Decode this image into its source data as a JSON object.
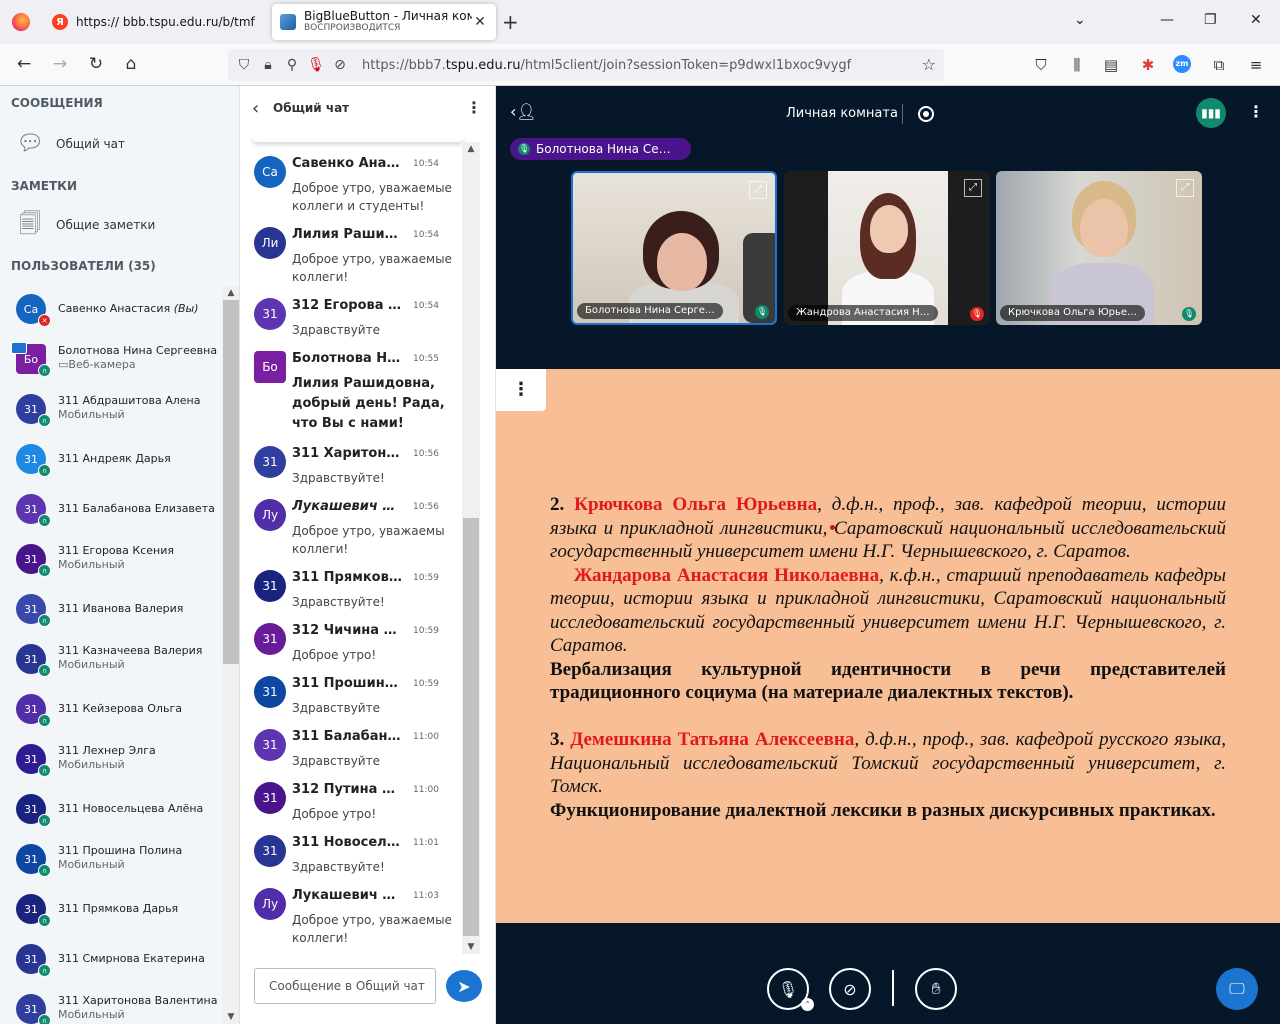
{
  "browser": {
    "tabs": [
      {
        "title": "https:// bbb.tspu.edu.ru/b/tmf",
        "favicon": "yandex-icon"
      },
      {
        "title": "BigBlueButton - Личная комна",
        "subtitle": "ВОСПРОИЗВОДИТСЯ",
        "favicon": "bbb-icon",
        "active": true
      }
    ],
    "url_prefix": "https://bbb7.",
    "url_domain": "tspu.edu.ru",
    "url_path": "/html5client/join?sessionToken=p9dwxl1bxoc9vygf",
    "yandex_letter": "Я",
    "zoom_label": "zm"
  },
  "left_panel": {
    "messages_title": "СООБЩЕНИЯ",
    "public_chat": "Общий чат",
    "notes_title": "ЗАМЕТКИ",
    "shared_notes": "Общие заметки",
    "users_title": "ПОЛЬЗОВАТЕЛИ (35)",
    "users": [
      {
        "initials": "Са",
        "name": "Савенко Анастасия",
        "you": "(Вы)",
        "sub": "",
        "color": "#1565c0",
        "status": "mute"
      },
      {
        "initials": "Бо",
        "name": "Болотнова Нина Сергеевна",
        "sub": "▭Веб-камера",
        "color": "#7b1fa2",
        "status": "listen",
        "presenter": true,
        "moderator": true
      },
      {
        "initials": "31",
        "name": "311 Абдрашитова Алена",
        "sub": "Мобильный",
        "color": "#303f9f",
        "status": "listen"
      },
      {
        "initials": "31",
        "name": "311 Андреяк Дарья",
        "sub": "",
        "color": "#1e88e5",
        "status": "listen"
      },
      {
        "initials": "31",
        "name": "311 Балабанова Елизавета",
        "sub": "",
        "color": "#5e35b1",
        "status": "listen"
      },
      {
        "initials": "31",
        "name": "311 Егорова Ксения",
        "sub": "Мобильный",
        "color": "#4a148c",
        "status": "listen"
      },
      {
        "initials": "31",
        "name": "311 Иванова Валерия",
        "sub": "",
        "color": "#3949ab",
        "status": "listen"
      },
      {
        "initials": "31",
        "name": "311 Казначеева Валерия",
        "sub": "Мобильный",
        "color": "#283593",
        "status": "listen"
      },
      {
        "initials": "31",
        "name": "311 Кейзерова Ольга",
        "sub": "",
        "color": "#512da8",
        "status": "listen"
      },
      {
        "initials": "31",
        "name": "311 Лехнер Элга",
        "sub": "Мобильный",
        "color": "#311b92",
        "status": "listen"
      },
      {
        "initials": "31",
        "name": "311 Новосельцева Алёна",
        "sub": "",
        "color": "#1a237e",
        "status": "listen"
      },
      {
        "initials": "31",
        "name": "311 Прошина Полина",
        "sub": "Мобильный",
        "color": "#0d47a1",
        "status": "listen"
      },
      {
        "initials": "31",
        "name": "311 Прямкова Дарья",
        "sub": "",
        "color": "#1a237e",
        "status": "listen"
      },
      {
        "initials": "31",
        "name": "311 Смирнова Екатерина",
        "sub": "",
        "color": "#283593",
        "status": "listen"
      },
      {
        "initials": "31",
        "name": "311 Харитонова Валентина",
        "sub": "Мобильный",
        "color": "#303f9f",
        "status": "listen"
      }
    ]
  },
  "chat": {
    "title": "Общий чат",
    "input_placeholder": "Сообщение в Общий чат",
    "messages": [
      {
        "initials": "Са",
        "name": "Савенко Анас…",
        "time": "10:54",
        "text": "Доброе утро, уважаемые коллеги и студенты!",
        "color": "#1565c0"
      },
      {
        "initials": "Ли",
        "name": "Лилия Рашид…",
        "time": "10:54",
        "text": "Доброе утро, уважаемые коллеги!",
        "color": "#283593"
      },
      {
        "initials": "31",
        "name": "312 Егорова П…",
        "time": "10:54",
        "text": "Здравствуйте",
        "color": "#5e35b1"
      },
      {
        "initials": "Бо",
        "name": "Болотнова Ни…",
        "time": "10:55",
        "text": "Лилия Рашидовна, добрый день! Рада, что Вы с нами!",
        "color": "#7b1fa2",
        "moderator": true,
        "bold": true
      },
      {
        "initials": "31",
        "name": "311 Харитонов…",
        "time": "10:56",
        "text": "Здравствуйте!",
        "color": "#303f9f"
      },
      {
        "initials": "Лу",
        "name": "Лукашевич Ел…",
        "time": "10:56",
        "text": "Доброе утро, уважаемы коллеги!",
        "color": "#512da8",
        "italic": true
      },
      {
        "initials": "31",
        "name": "311 Прямкова …",
        "time": "10:59",
        "text": "Здравствуйте!",
        "color": "#1a237e"
      },
      {
        "initials": "31",
        "name": "312 Чичина Ол…",
        "time": "10:59",
        "text": "Доброе утро!",
        "color": "#6a1b9a"
      },
      {
        "initials": "31",
        "name": "311 Прошина …",
        "time": "10:59",
        "text": "Здравствуйте",
        "color": "#0d47a1"
      },
      {
        "initials": "31",
        "name": "311 Балабано…",
        "time": "11:00",
        "text": "Здравствуйте",
        "color": "#5e35b1"
      },
      {
        "initials": "31",
        "name": "312 Путина Со…",
        "time": "11:00",
        "text": "Доброе утро!",
        "color": "#4a148c"
      },
      {
        "initials": "31",
        "name": "311 Новосель…",
        "time": "11:01",
        "text": "Здравствуйте!",
        "color": "#283593"
      },
      {
        "initials": "Лу",
        "name": "Лукашевич Ел…",
        "time": "11:03",
        "text": "Доброе утро, уважаемые коллеги!",
        "color": "#512da8"
      }
    ]
  },
  "main": {
    "room_title": "Личная комната",
    "talking_indicator": "Болотнова Нина Се…",
    "videos": [
      {
        "name": "Болотнова Нина Серге…",
        "mic": "on",
        "active": true
      },
      {
        "name": "Жандрова Анастасия Н…",
        "mic": "muted"
      },
      {
        "name": "Крючкова Ольга Юрье…",
        "mic": "on"
      }
    ],
    "slide": {
      "item2_num": "2.",
      "item2_name": "Крючкова Ольга Юрьевна",
      "item2_desc": ", д.ф.н., проф., зав. кафедрой теории, истории языка и прикладной лингвистики, Саратовский национальный исследовательский государственный университет имени Н.Г. Чернышевского, г. Саратов.",
      "item2b_name": "Жандарова Анастасия Николаевна",
      "item2b_desc": ", к.ф.н., старший преподаватель кафедры теории, истории языка и прикладной лингвистики, Саратовский национальный исследовательский государственный университет имени Н.Г. Чернышевского, г. Саратов.",
      "item2_topic": "Вербализация культурной идентичности в речи представителей традиционного социума (на материале диалектных текстов).",
      "item3_num": "3.",
      "item3_name": "Демешкина Татьяна Алексеевна",
      "item3_desc": ", д.ф.н., проф., зав. кафедрой русского языка, Национальный исследовательский Томский государственный университет, г. Томск.",
      "item3_topic": "Функционирование диалектной лексики в разных дискурсивных практиках."
    }
  },
  "colors": {
    "accent": "#1b75d0",
    "listen_green": "#0f8a6e",
    "slide_bg": "#f8bf96",
    "slide_red": "#e01a1a",
    "main_bg": "#06172a"
  }
}
